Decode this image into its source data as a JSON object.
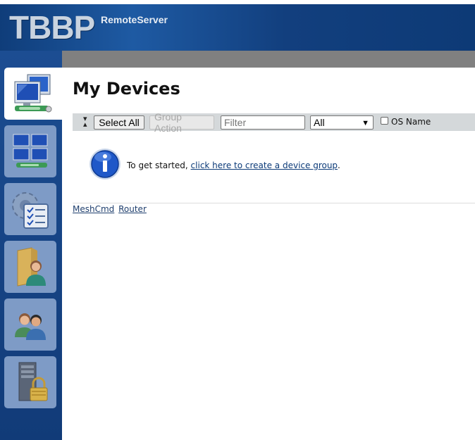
{
  "header": {
    "logo": "TBBP",
    "subtitle": "RemoteServer"
  },
  "sidebar": {
    "items": [
      {
        "name": "my-devices",
        "icon": "computers-icon",
        "active": true
      },
      {
        "name": "my-desktops",
        "icon": "monitors-grid-icon",
        "active": false
      },
      {
        "name": "my-events",
        "icon": "gear-checklist-icon",
        "active": false
      },
      {
        "name": "my-files",
        "icon": "folder-user-icon",
        "active": false
      },
      {
        "name": "my-users",
        "icon": "users-icon",
        "active": false
      },
      {
        "name": "my-server",
        "icon": "server-lock-icon",
        "active": false
      }
    ]
  },
  "page": {
    "title": "My Devices"
  },
  "toolbar": {
    "select_all": "Select All",
    "group_action": "Group Action",
    "filter_placeholder": "Filter",
    "filter_value": "",
    "group_select_value": "All",
    "os_name_label": "OS Name",
    "os_name_checked": false
  },
  "info": {
    "text_before": "To get started, ",
    "link_text": "click here to create a device group",
    "text_after": "."
  },
  "footer": {
    "links": [
      "MeshCmd",
      "Router"
    ]
  },
  "colors": {
    "header_blue": "#123f7e",
    "sidebar_blue": "#113b78",
    "link": "#0b3a78"
  }
}
